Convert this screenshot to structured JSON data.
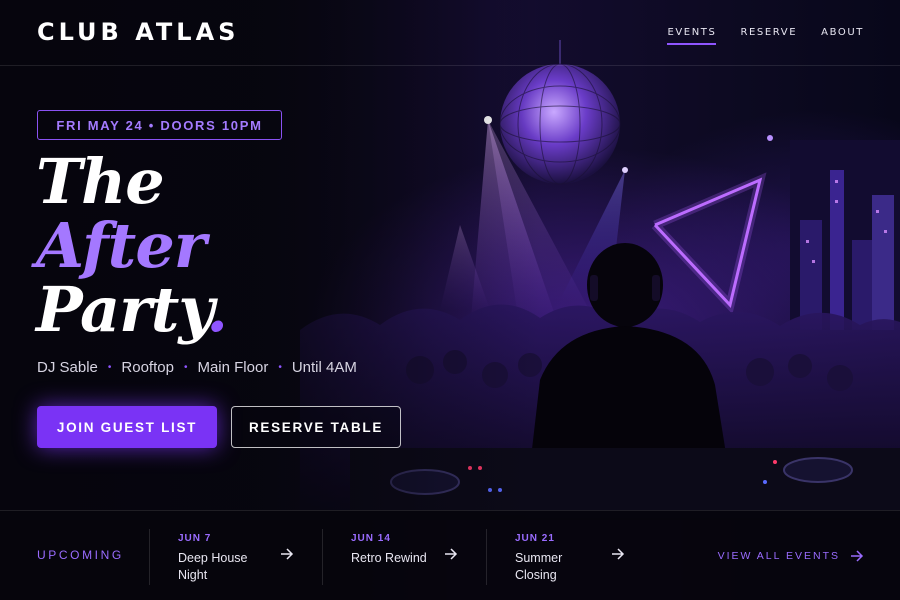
{
  "header": {
    "logo": "CLUB ATLAS",
    "nav": [
      {
        "label": "EVENTS",
        "active": true
      },
      {
        "label": "RESERVE",
        "active": false
      },
      {
        "label": "ABOUT",
        "active": false
      }
    ]
  },
  "hero": {
    "date_badge": "FRI MAY 24 • DOORS 10PM",
    "headline": {
      "line1": "The",
      "line2": "After",
      "line3": "Party",
      "punct": "."
    },
    "meta": [
      "DJ Sable",
      "Rooftop",
      "Main Floor",
      "Until 4AM"
    ],
    "meta_separator": "•",
    "primary_button": "JOIN GUEST LIST",
    "secondary_button": "RESERVE TABLE"
  },
  "upcoming": {
    "label": "UPCOMING",
    "events": [
      {
        "date": "JUN 7",
        "name": "Deep House Night"
      },
      {
        "date": "JUN 14",
        "name": "Retro Rewind"
      },
      {
        "date": "JUN 21",
        "name": "Summer Closing"
      }
    ],
    "view_all": "VIEW ALL EVENTS"
  },
  "colors": {
    "accent": "#7a33f5",
    "accent_light": "#a478ff",
    "background": "#06050d"
  },
  "icons": {
    "event_arrow": "arrow-right-icon",
    "view_all_arrow": "arrow-right-icon"
  }
}
